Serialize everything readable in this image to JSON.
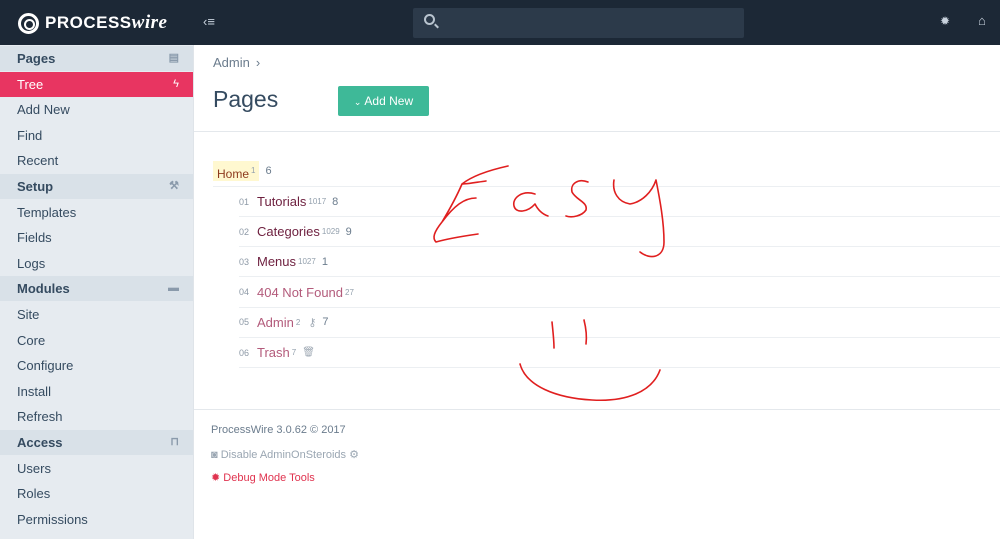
{
  "app": {
    "logo_text": "PROCESS",
    "logo_italic": "wire"
  },
  "search": {
    "placeholder": ""
  },
  "sidebar": {
    "items": [
      {
        "label": "Pages",
        "type": "heading",
        "icon": "file-icon"
      },
      {
        "label": "Tree",
        "type": "active",
        "icon": "bolt-icon"
      },
      {
        "label": "Add New",
        "type": "item"
      },
      {
        "label": "Find",
        "type": "item"
      },
      {
        "label": "Recent",
        "type": "item"
      },
      {
        "label": "Setup",
        "type": "heading",
        "icon": "wrench-icon"
      },
      {
        "label": "Templates",
        "type": "item"
      },
      {
        "label": "Fields",
        "type": "item"
      },
      {
        "label": "Logs",
        "type": "item"
      },
      {
        "label": "Modules",
        "type": "heading",
        "icon": "briefcase-icon"
      },
      {
        "label": "Site",
        "type": "item"
      },
      {
        "label": "Core",
        "type": "item"
      },
      {
        "label": "Configure",
        "type": "item"
      },
      {
        "label": "Install",
        "type": "item"
      },
      {
        "label": "Refresh",
        "type": "item"
      },
      {
        "label": "Access",
        "type": "heading",
        "icon": "unlock-icon"
      },
      {
        "label": "Users",
        "type": "item"
      },
      {
        "label": "Roles",
        "type": "item"
      },
      {
        "label": "Permissions",
        "type": "item"
      }
    ]
  },
  "breadcrumb": {
    "item": "Admin",
    "sep": "›"
  },
  "main": {
    "title": "Pages",
    "add_new_label": "Add New"
  },
  "tree": {
    "home": {
      "label": "Home",
      "id": "1",
      "count": "6"
    },
    "rows": [
      {
        "num": "01",
        "label": "Tutorials",
        "id": "1017",
        "count": "8",
        "hidden": false
      },
      {
        "num": "02",
        "label": "Categories",
        "id": "1029",
        "count": "9",
        "hidden": false
      },
      {
        "num": "03",
        "label": "Menus",
        "id": "1027",
        "count": "1",
        "hidden": false
      },
      {
        "num": "04",
        "label": "404 Not Found",
        "id": "27",
        "count": "",
        "hidden": true
      },
      {
        "num": "05",
        "label": "Admin",
        "id": "2",
        "count": "7",
        "hidden": true
      },
      {
        "num": "06",
        "label": "Trash",
        "id": "7",
        "count": "",
        "hidden": true
      }
    ]
  },
  "footer": {
    "version": "ProcessWire 3.0.62 © 2017",
    "aos": "Disable AdminOnSteroids",
    "debug": "Debug Mode Tools"
  },
  "handwriting": {
    "text": "Easy",
    "color": "#e01f1f"
  },
  "colors": {
    "topbar": "#1c2836",
    "accent": "#e83561",
    "button": "#3eb998"
  }
}
